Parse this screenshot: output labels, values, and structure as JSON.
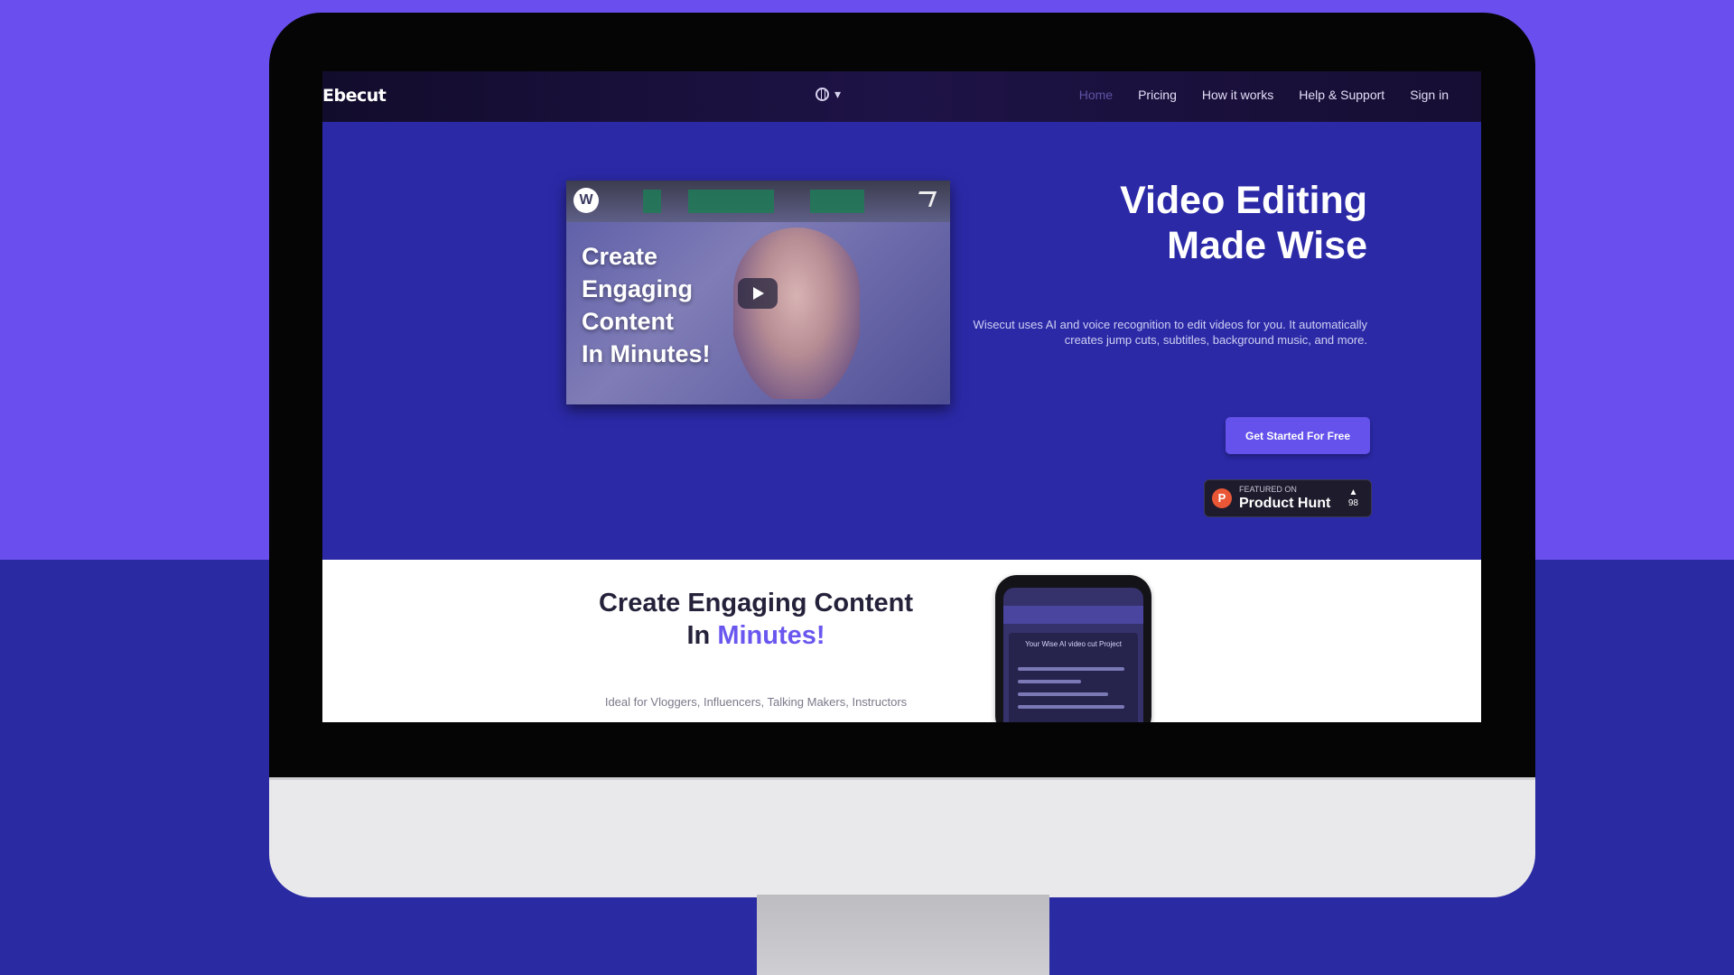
{
  "nav": {
    "logo": "Ebecut",
    "language_caret": "▾",
    "links": [
      "Home",
      "Pricing",
      "How it works",
      "Help & Support",
      "Sign in"
    ]
  },
  "hero": {
    "video": {
      "channel_initial": "W",
      "overlay_lines": [
        "Create",
        "Engaging",
        "Content",
        "In Minutes!"
      ]
    },
    "title_lines": [
      "Video Editing",
      "Made Wise"
    ],
    "description": "Wisecut uses AI and voice recognition to edit videos for you. It automatically creates jump cuts, subtitles, background music, and more.",
    "cta_label": "Get Started For Free",
    "product_hunt": {
      "small_label": "FEATURED ON",
      "name": "Product Hunt",
      "vote_arrow": "▲",
      "vote_count": "98"
    }
  },
  "section": {
    "title_line1": "Create Engaging Content",
    "title_line2_prefix": "In ",
    "title_line2_accent": "Minutes!",
    "subtitle": "Ideal for Vloggers, Influencers, Talking Makers, Instructors",
    "phone_card_title": "Your Wise AI video cut Project"
  },
  "colors": {
    "page_bg": "#6b4fee",
    "screen_bg": "#2b29a6",
    "accent": "#6a57ef",
    "cta": "#6552ec"
  }
}
